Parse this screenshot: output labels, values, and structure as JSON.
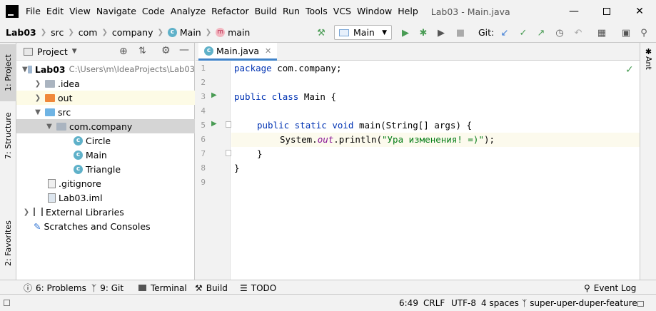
{
  "menu": [
    "File",
    "Edit",
    "View",
    "Navigate",
    "Code",
    "Analyze",
    "Refactor",
    "Build",
    "Run",
    "Tools",
    "VCS",
    "Window",
    "Help"
  ],
  "window_title": "Lab03 - Main.java",
  "breadcrumb": {
    "project": "Lab03",
    "p1": "src",
    "p2": "com",
    "p3": "company",
    "cls": "Main",
    "method": "main"
  },
  "run_config": "Main",
  "git_label": "Git:",
  "project_panel": {
    "title": "Project"
  },
  "tree": [
    {
      "label": "Lab03",
      "path": "C:\\Users\\m\\IdeaProjects\\Lab03"
    },
    {
      "label": ".idea"
    },
    {
      "label": "out"
    },
    {
      "label": "src"
    },
    {
      "label": "com.company"
    },
    {
      "label": "Circle"
    },
    {
      "label": "Main"
    },
    {
      "label": "Triangle"
    },
    {
      "label": ".gitignore"
    },
    {
      "label": "Lab03.iml"
    },
    {
      "label": "External Libraries"
    },
    {
      "label": "Scratches and Consoles"
    }
  ],
  "editor_tab": "Main.java",
  "left_tabs": {
    "project": "1: Project",
    "structure": "7: Structure",
    "favorites": "2: Favorites"
  },
  "right_tabs": {
    "ant": "Ant"
  },
  "code": {
    "l1_kw": "package",
    "l1_rest": " com.company;",
    "l3_kw": "public class",
    "l3_rest": " Main {",
    "l5_kw": "public static void",
    "l5_rest": " main(String[] args) {",
    "l6_a": "System.",
    "l6_out": "out",
    "l6_b": ".println(",
    "l6_str": "\"Ура изменения! =)\"",
    "l6_c": ");",
    "l7": "}",
    "l8": "}"
  },
  "line_numbers": [
    "1",
    "2",
    "3",
    "4",
    "5",
    "6",
    "7",
    "8",
    "9"
  ],
  "bottom_tools": {
    "problems": "6: Problems",
    "git": "9: Git",
    "terminal": "Terminal",
    "build": "Build",
    "todo": "TODO",
    "event_log": "Event Log"
  },
  "status": {
    "pos": "6:49",
    "eol": "CRLF",
    "enc": "UTF-8",
    "indent": "4 spaces",
    "branch": "super-uper-duper-feature"
  },
  "colors": {
    "accent": "#4083c9",
    "keyword": "#0033b3",
    "string": "#067d17",
    "run_green": "#499c54",
    "folder_blue": "#6fb4e4",
    "folder_orange": "#f0883a"
  }
}
